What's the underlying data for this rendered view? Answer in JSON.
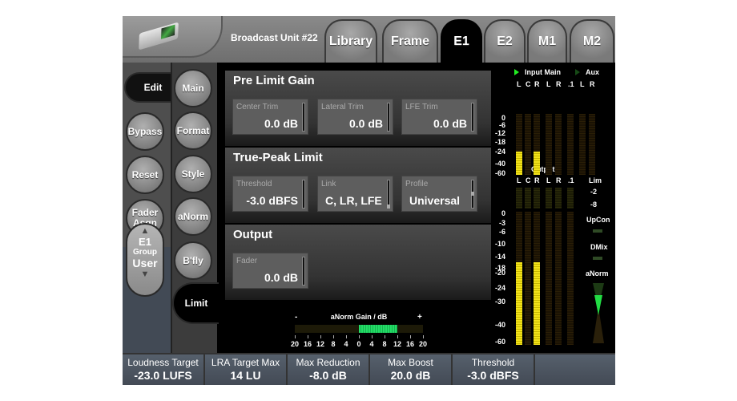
{
  "header": {
    "title": "Broadcast Unit #22",
    "tabs": [
      {
        "label": "Library"
      },
      {
        "label": "Frame"
      },
      {
        "label": "E1",
        "selected": true
      },
      {
        "label": "E2"
      },
      {
        "label": "M1"
      },
      {
        "label": "M2"
      }
    ]
  },
  "left_buttons": {
    "edit": "Edit",
    "bypass": "Bypass",
    "reset": "Reset",
    "fader_line1": "Fader",
    "fader_line2": "Asgn",
    "group_top": "E1",
    "group_mid": "Group",
    "group_bottom": "User"
  },
  "mode_buttons": {
    "main": "Main",
    "format": "Format",
    "style": "Style",
    "anorm": "aNorm",
    "bfly": "B'fly",
    "limit": "Limit"
  },
  "panels": {
    "pre_limit": {
      "title": "Pre Limit Gain",
      "fields": [
        {
          "label": "Center Trim",
          "value": "0.0 dB"
        },
        {
          "label": "Lateral Trim",
          "value": "0.0 dB"
        },
        {
          "label": "LFE Trim",
          "value": "0.0 dB"
        }
      ]
    },
    "true_peak": {
      "title": "True-Peak Limit",
      "fields": [
        {
          "label": "Threshold",
          "value": "-3.0 dBFS"
        },
        {
          "label": "Link",
          "value": "C, LR, LFE"
        },
        {
          "label": "Profile",
          "value": "Universal"
        }
      ]
    },
    "output": {
      "title": "Output",
      "fields": [
        {
          "label": "Fader",
          "value": "0.0 dB"
        }
      ]
    }
  },
  "anorm_gain": {
    "title": "aNorm Gain / dB",
    "minus": "-",
    "plus": "+",
    "ticks": [
      "20",
      "16",
      "12",
      "8",
      "4",
      "0",
      "4",
      "8",
      "12",
      "16",
      "20"
    ],
    "value_db": 12
  },
  "meters": {
    "input_main": "Input Main",
    "aux": "Aux",
    "input_channels": [
      "L",
      "C",
      "R",
      "L",
      "R",
      ".1",
      "L",
      "R"
    ],
    "input_scale": [
      "0",
      "-6",
      "-12",
      "-18",
      "-24",
      "-40",
      "-60"
    ],
    "input_levels_db": [
      -24,
      null,
      -24,
      null,
      null,
      null,
      null,
      null
    ],
    "output_title": "Output",
    "output_channels": [
      "L",
      "C",
      "R",
      "L",
      "R",
      ".1"
    ],
    "lim": "Lim",
    "lim_scale": [
      "-2",
      "-8"
    ],
    "output_scale": [
      "0",
      "-3",
      "-6",
      "-10",
      "-14",
      "-18",
      "-20",
      "-24",
      "-30",
      "-40",
      "-60"
    ],
    "output_levels_db": [
      -16,
      null,
      -16,
      null,
      null,
      null
    ],
    "upcon": "UpCon",
    "dmix": "DMix",
    "anorm": "aNorm",
    "active_color": "#f2e21a",
    "anorm_color": "#22dd44"
  },
  "bottom_bar": [
    {
      "label": "Loudness Target",
      "value": "-23.0 LUFS"
    },
    {
      "label": "LRA Target Max",
      "value": "14 LU"
    },
    {
      "label": "Max Reduction",
      "value": "-8.0 dB"
    },
    {
      "label": "Max Boost",
      "value": "20.0 dB"
    },
    {
      "label": "Threshold",
      "value": "-3.0 dBFS"
    }
  ]
}
